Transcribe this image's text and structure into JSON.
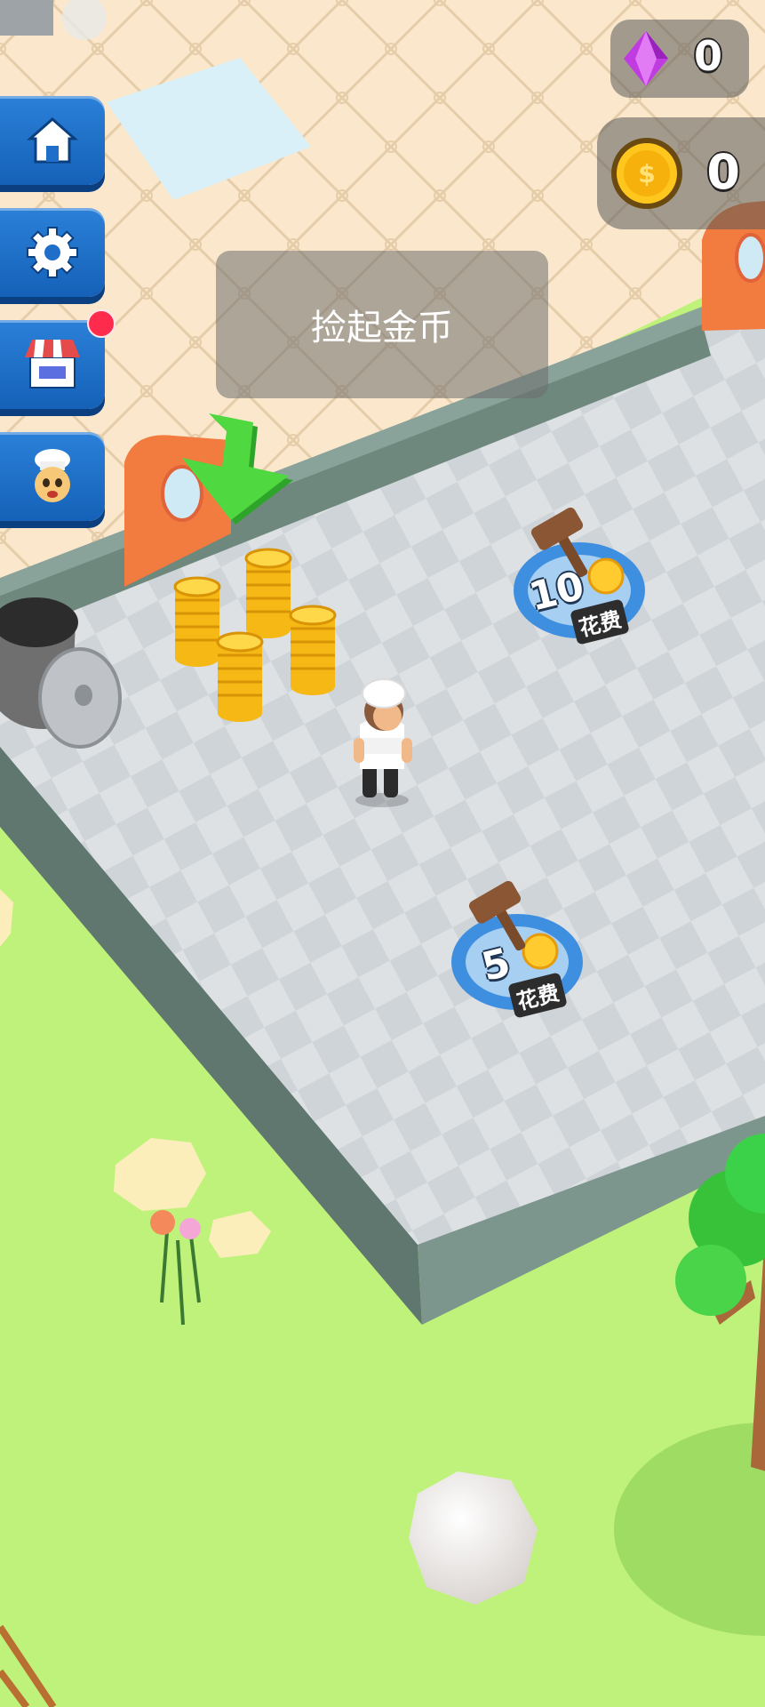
{
  "hud": {
    "gems": "0",
    "coins": "0"
  },
  "sidebar": {
    "items": [
      {
        "name": "home-button",
        "icon": "home-icon"
      },
      {
        "name": "settings-button",
        "icon": "gear-icon"
      },
      {
        "name": "shop-button",
        "icon": "shop-icon",
        "notification": true
      },
      {
        "name": "chef-button",
        "icon": "chef-icon"
      }
    ]
  },
  "toast": {
    "message": "捡起金币"
  },
  "build_spots": [
    {
      "cost": "10",
      "label": "花费"
    },
    {
      "cost": "5",
      "label": "花费"
    }
  ],
  "colors": {
    "grass": "#bff27a",
    "floor_light": "#dfe3e6",
    "floor_dark": "#cfd4d8",
    "wall": "#6f8a80",
    "button_blue": "#1f6fca",
    "coin_gold": "#f7c21a",
    "arrow_green": "#47d23b",
    "gem_purple": "#c13ce0"
  }
}
